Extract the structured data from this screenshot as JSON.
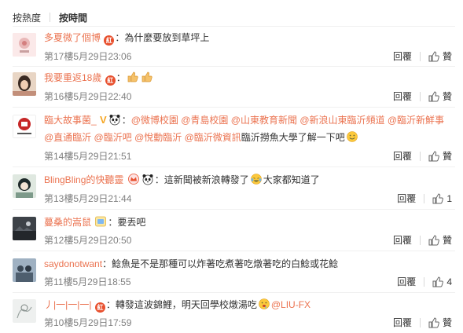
{
  "sort": {
    "by_hot": "按熱度",
    "by_time": "按時間"
  },
  "actions": {
    "reply": "回覆",
    "like": "贊"
  },
  "colors": {
    "username": "#eb7350",
    "meta": "#808080",
    "badge": "#e8502e"
  },
  "comments": [
    {
      "user": "多夏微了個博",
      "text": "：為什麼要放到草坪上",
      "meta": "第17樓5月29日23:06",
      "like_count": "",
      "avatar": "avatar-flower-icon"
    },
    {
      "user": "我要重返18歲",
      "text": "：",
      "meta": "第16樓5月29日22:40",
      "like_count": "",
      "avatar": "avatar-girl-photo-icon"
    },
    {
      "user": "臨大故事菌_",
      "text_pre": "：",
      "mentions": [
        "@微博校園",
        "@青島校園",
        "@山東教育新聞",
        "@新浪山東臨沂頻道",
        "@臨沂新鮮事",
        "@直通臨沂",
        "@臨沂吧",
        "@悅動臨沂",
        "@臨沂微資訊"
      ],
      "text_post": "臨沂撈魚大學了解一下吧",
      "meta": "第14樓5月29日21:51",
      "like_count": "",
      "avatar": "avatar-university-logo-icon"
    },
    {
      "user": "BlingBling的快聽靈",
      "text": "：這新聞被新浪轉發了",
      "text2": "大家都知道了",
      "meta": "第13樓5月29日21:44",
      "like_count": "1",
      "avatar": "avatar-cartoon-icon"
    },
    {
      "user": "蔓桑的嵩鼠",
      "text": "：要丟吧",
      "meta": "第12樓5月29日20:50",
      "like_count": "",
      "avatar": "avatar-night-photo-icon"
    },
    {
      "user": "saydonotwant",
      "text": "：鯰魚是不是那種可以炸著吃煮著吃燉著吃的白鯰或花鯰",
      "meta": "第11樓5月29日18:55",
      "like_count": "4",
      "avatar": "avatar-people-photo-icon"
    },
    {
      "user": "丿|一|一|一|",
      "text": "：轉發這波錦鯉，明天回學校燉湯吃",
      "mention": "@LIU-FX",
      "meta": "第10樓5月29日17:59",
      "like_count": "",
      "avatar": "avatar-sketch-icon"
    }
  ]
}
